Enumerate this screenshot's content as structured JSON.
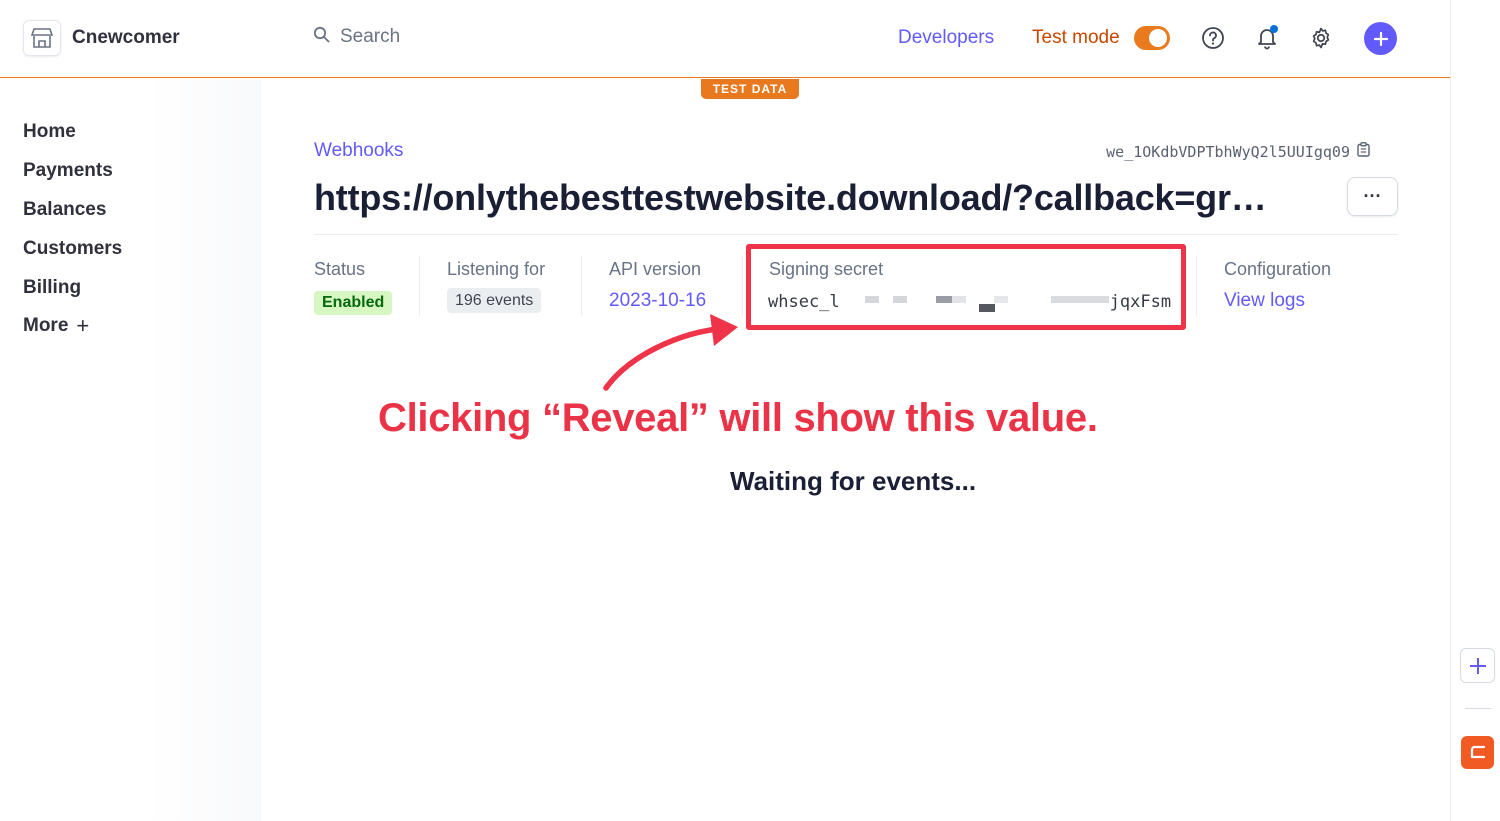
{
  "header": {
    "account_name": "Cnewcomer",
    "search_placeholder": "Search",
    "developers_label": "Developers",
    "test_mode_label": "Test mode",
    "test_mode_on": true,
    "test_data_badge": "TEST DATA"
  },
  "sidebar": {
    "items": [
      {
        "label": "Home"
      },
      {
        "label": "Payments"
      },
      {
        "label": "Balances"
      },
      {
        "label": "Customers"
      },
      {
        "label": "Billing"
      },
      {
        "label": "More",
        "suffix": "+"
      }
    ]
  },
  "webhook": {
    "breadcrumb": "Webhooks",
    "id": "we_1OKdbVDPTbhWyQ2l5UUIgq09",
    "endpoint_url": "https://onlythebesttestwebsite.download/?callback=gr…",
    "more_label": "···",
    "meta": {
      "status_label": "Status",
      "status_value": "Enabled",
      "listening_label": "Listening for",
      "listening_value": "196 events",
      "api_label": "API version",
      "api_value": "2023-10-16",
      "secret_label": "Signing secret",
      "secret_prefix": "whsec_l",
      "secret_suffix": "jqxFsm",
      "config_label": "Configuration",
      "config_value": "View logs"
    },
    "waiting_text": "Waiting for events..."
  },
  "annotation": {
    "text": "Clicking “Reveal” will show this value.",
    "color": "#ea3346"
  },
  "colors": {
    "accent": "#625afa",
    "test_mode": "#e8791e",
    "status_green_bg": "#d7f7c2",
    "status_green_text": "#05690d",
    "annotation_red": "#ef3348"
  },
  "icons": {
    "brand": "storefront-icon",
    "search": "search-icon",
    "help": "help-icon",
    "notifications": "bell-icon",
    "settings": "gear-icon",
    "create": "plus-icon",
    "copy": "clipboard-icon"
  }
}
